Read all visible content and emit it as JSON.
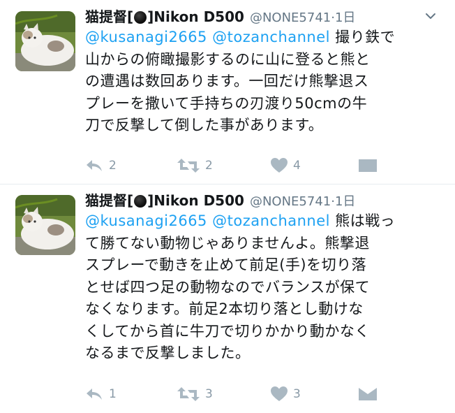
{
  "tweets": [
    {
      "display_name_pre": "猫提督[",
      "display_name_post": "]Nikon D500",
      "handle": "@NONE5741",
      "separator": "·",
      "time": "1日",
      "mention1": "@kusanagi2665",
      "mention2": "@tozanchannel",
      "text": " 撮り鉄で\n山からの俯瞰撮影するのに山に登ると熊と\nの遭遇は数回あります。一回だけ熊撃退ス\nプレーを撒いて手持ちの刃渡り50cmの牛\n刀で反撃して倒した事があります。",
      "replies": "2",
      "retweets": "2",
      "likes": "4"
    },
    {
      "display_name_pre": "猫提督[",
      "display_name_post": "]Nikon D500",
      "handle": "@NONE5741",
      "separator": "·",
      "time": "1日",
      "mention1": "@kusanagi2665",
      "mention2": "@tozanchannel",
      "text": " 熊は戦っ\nて勝てない動物じゃありませんよ。熊撃退\nスプレーで動きを止めて前足(手)を切り落\nとせば四つ足の動物なのでバランスが保て\nなくなります。前足2本切り落とし動けな\nくしてから首に牛刀で切りかかり動かなく\nなるまで反撃しました。",
      "replies": "1",
      "retweets": "3",
      "likes": "3"
    }
  ],
  "colors": {
    "mention": "#1da1f2",
    "meta": "#657786",
    "icon": "#aab8c2"
  }
}
